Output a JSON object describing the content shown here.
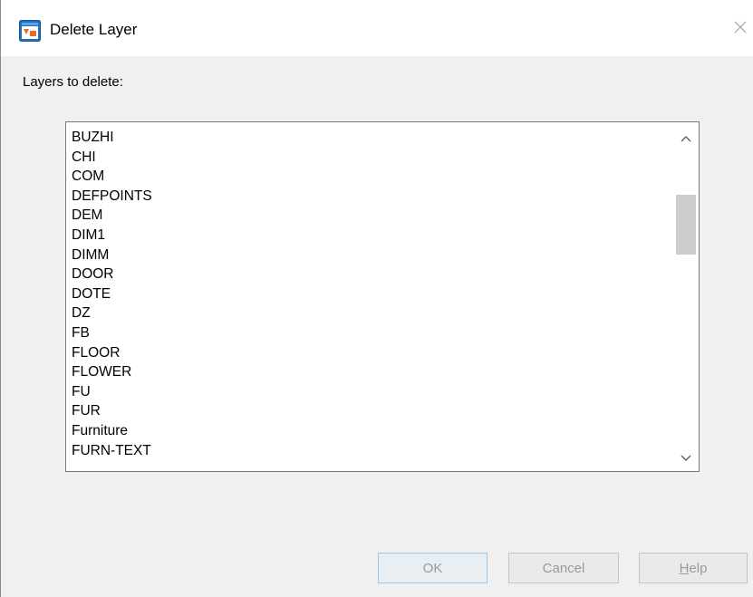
{
  "dialog": {
    "title": "Delete Layer",
    "label": "Layers to delete:",
    "icons": {
      "app": "app-window-icon",
      "close": "close-icon",
      "scroll_up": "chevron-up-icon",
      "scroll_down": "chevron-down-icon"
    }
  },
  "layers": [
    "BUZHI",
    "CHI",
    "COM",
    "DEFPOINTS",
    "DEM",
    "DIM1",
    "DIMM",
    "DOOR",
    "DOTE",
    "DZ",
    "FB",
    "FLOOR",
    "FLOWER",
    "FU",
    "FUR",
    "Furniture",
    "FURN-TEXT"
  ],
  "buttons": {
    "ok": "OK",
    "cancel": "Cancel",
    "help_first": "H",
    "help_rest": "elp"
  },
  "colors": {
    "accent_border": "#9fc4e6",
    "disabled_text": "#9a9a9a",
    "icon_blue": "#1e6fc4",
    "icon_orange": "#e8692a"
  }
}
